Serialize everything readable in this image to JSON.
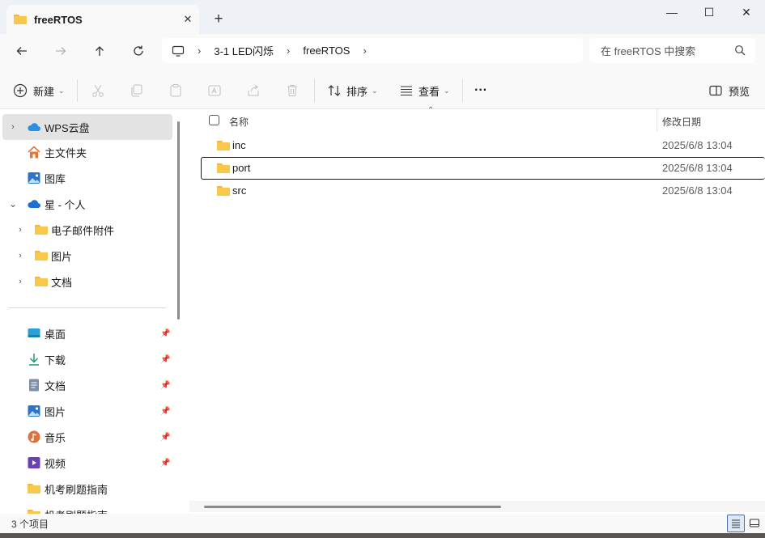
{
  "window": {
    "tab_title": "freeRTOS",
    "tab_close": "✕",
    "new_tab": "+",
    "minimize": "—",
    "maximize": "☐",
    "close": "✕"
  },
  "nav": {
    "back_icon": "arrow-left-icon",
    "forward_icon": "arrow-right-icon",
    "up_icon": "arrow-up-icon",
    "refresh_icon": "refresh-icon"
  },
  "breadcrumb": {
    "items": [
      "3-1 LED闪烁",
      "freeRTOS"
    ],
    "separator": "›"
  },
  "search": {
    "placeholder": "在 freeRTOS 中搜索"
  },
  "command_bar": {
    "new_label": "新建",
    "sort_label": "排序",
    "view_label": "查看",
    "more_label": "···",
    "preview_label": "预览"
  },
  "sidebar": {
    "items": [
      {
        "label": "WPS云盘",
        "icon": "cloud-icon",
        "pinned": false
      },
      {
        "label": "主文件夹",
        "icon": "home-icon",
        "pinned": false
      },
      {
        "label": "图库",
        "icon": "gallery-icon",
        "pinned": false
      },
      {
        "label": "星 - 个人",
        "icon": "onedrive-icon",
        "pinned": false
      },
      {
        "label": "电子邮件附件",
        "icon": "folder-icon",
        "pinned": false
      },
      {
        "label": "图片",
        "icon": "folder-icon",
        "pinned": false
      },
      {
        "label": "文档",
        "icon": "folder-icon",
        "pinned": false
      },
      {
        "label": "桌面",
        "icon": "desktop-icon",
        "pinned": true
      },
      {
        "label": "下载",
        "icon": "download-icon",
        "pinned": true
      },
      {
        "label": "文档",
        "icon": "document-icon",
        "pinned": true
      },
      {
        "label": "图片",
        "icon": "picture-icon",
        "pinned": true
      },
      {
        "label": "音乐",
        "icon": "music-icon",
        "pinned": true
      },
      {
        "label": "视频",
        "icon": "video-icon",
        "pinned": true
      },
      {
        "label": "机考刷题指南",
        "icon": "folder-icon",
        "pinned": false
      },
      {
        "label": "机考刷题指南",
        "icon": "folder-icon",
        "pinned": false
      }
    ]
  },
  "file_list": {
    "columns": {
      "name": "名称",
      "modified": "修改日期"
    },
    "rows": [
      {
        "name": "inc",
        "modified": "2025/6/8 13:04"
      },
      {
        "name": "port",
        "modified": "2025/6/8 13:04"
      },
      {
        "name": "src",
        "modified": "2025/6/8 13:04"
      }
    ]
  },
  "status": {
    "item_count": "3 个项目"
  },
  "colors": {
    "folder": "#f7c84b",
    "accent": "#0067c0"
  }
}
